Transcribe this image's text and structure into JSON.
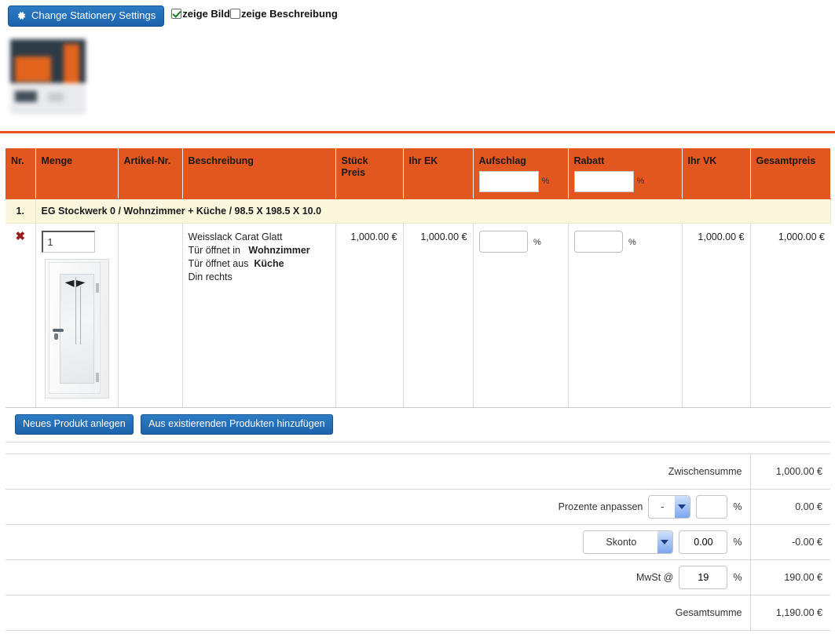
{
  "toolbar": {
    "settings_button": "Change Stationery Settings",
    "gear_icon": "gear-icon",
    "checkbox_image_label": "zeige Bild",
    "checkbox_image_checked": true,
    "checkbox_description_label": "zeige Beschreibung",
    "checkbox_description_checked": false
  },
  "colors": {
    "accent_orange": "#e2561f",
    "divider_orange": "#e8541f",
    "group_row_cream": "#faf7dc",
    "button_blue": "#1b62ab",
    "delete_red": "#9c1c22"
  },
  "table": {
    "headers": {
      "nr": "Nr.",
      "menge": "Menge",
      "artikel_nr": "Artikel-Nr.",
      "beschreibung": "Beschreibung",
      "stueck_preis": "Stück Preis",
      "stueck_preis_l1": "Stück",
      "stueck_preis_l2": "Preis",
      "ihr_ek": "Ihr EK",
      "aufschlag": "Aufschlag",
      "rabatt": "Rabatt",
      "ihr_vk": "Ihr VK",
      "gesamtpreis": "Gesamtpreis"
    },
    "header_inputs": {
      "aufschlag_value": "",
      "rabatt_value": "",
      "percent_sign": "%"
    },
    "groups": [
      {
        "nr": "1.",
        "title": "EG Stockwerk 0 / Wohnzimmer + Küche / 98.5 X 198.5 X 10.0"
      }
    ],
    "rows": [
      {
        "delete_icon": "✖",
        "quantity": "1",
        "artikel_nr": "",
        "description": {
          "title": "Weisslack Carat Glatt",
          "line2_label": "Tür öffnet in",
          "line2_value": "Wohnzimmer",
          "line3_label": "Tür öffnet aus",
          "line3_value": "Küche",
          "line4": "Din rechts"
        },
        "stueck_preis": "1,000.00 €",
        "ihr_ek": "1,000.00 €",
        "aufschlag_value": "",
        "rabatt_value": "",
        "ihr_vk": "1,000.00 €",
        "gesamtpreis": "1,000.00 €",
        "image_alt": "white door with frosted glass panel"
      }
    ]
  },
  "actions": {
    "new_product": "Neues Produkt anlegen",
    "add_existing": "Aus existierenden Produkten hinzufügen"
  },
  "totals": {
    "percent_sign": "%",
    "rows": [
      {
        "id": "zwischensumme",
        "label": "Zwischensumme",
        "value": "1,000.00 €"
      },
      {
        "id": "prozente-anpassen",
        "label": "Prozente anpassen",
        "select_value": "-",
        "input_value": "",
        "value": "0.00 €"
      },
      {
        "id": "skonto",
        "label": "",
        "select_value": "Skonto",
        "input_value": "0.00",
        "value": "-0.00 €"
      },
      {
        "id": "mwst",
        "label": "MwSt @",
        "input_value": "19",
        "value": "190.00 €"
      },
      {
        "id": "gesamtsumme",
        "label": "Gesamtsumme",
        "value": "1,190.00 €"
      }
    ]
  }
}
